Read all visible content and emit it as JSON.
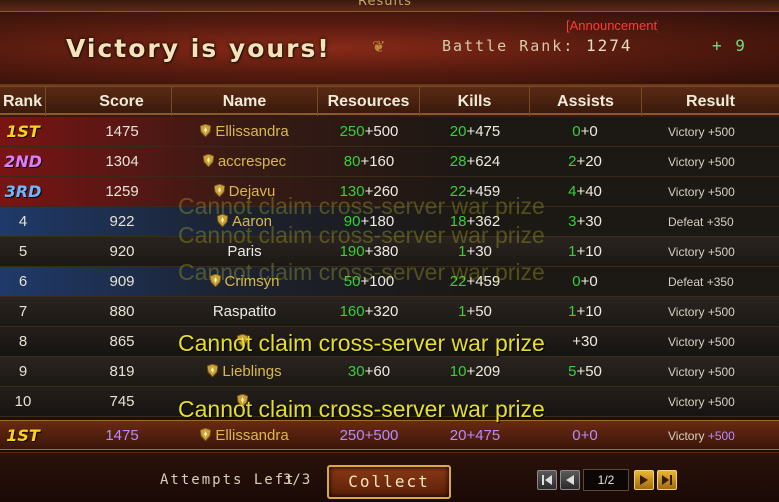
{
  "top_tab": {
    "label": "Results"
  },
  "header": {
    "title": "Victory is yours!",
    "announcement": "[Announcement]",
    "battle_rank_label": "Battle Rank:",
    "battle_rank_value": "1274",
    "rank_change": "+ 9"
  },
  "columns": [
    "Rank",
    "Score",
    "Name",
    "Resources",
    "Kills",
    "Assists",
    "Result"
  ],
  "rows": [
    {
      "rank": "1ST",
      "score": "1475",
      "name": "Ellissandra",
      "shield": true,
      "res_base": "250",
      "res_bonus": "+500",
      "kills_base": "20",
      "kills_bonus": "+475",
      "assists_base": "0",
      "assists_bonus": "+0",
      "result_label": "Victory",
      "result_bonus": "+500"
    },
    {
      "rank": "2ND",
      "score": "1304",
      "name": "accrespec",
      "shield": true,
      "res_base": "80",
      "res_bonus": "+160",
      "kills_base": "28",
      "kills_bonus": "+624",
      "assists_base": "2",
      "assists_bonus": "+20",
      "result_label": "Victory",
      "result_bonus": "+500"
    },
    {
      "rank": "3RD",
      "score": "1259",
      "name": "Dejavu",
      "shield": true,
      "res_base": "130",
      "res_bonus": "+260",
      "kills_base": "22",
      "kills_bonus": "+459",
      "assists_base": "4",
      "assists_bonus": "+40",
      "result_label": "Victory",
      "result_bonus": "+500"
    },
    {
      "rank": "4",
      "score": "922",
      "name": "Aaron",
      "shield": true,
      "res_base": "90",
      "res_bonus": "+180",
      "kills_base": "18",
      "kills_bonus": "+362",
      "assists_base": "3",
      "assists_bonus": "+30",
      "result_label": "Defeat",
      "result_bonus": "+350"
    },
    {
      "rank": "5",
      "score": "920",
      "name": "Paris",
      "shield": false,
      "res_base": "190",
      "res_bonus": "+380",
      "kills_base": "1",
      "kills_bonus": "+30",
      "assists_base": "1",
      "assists_bonus": "+10",
      "result_label": "Victory",
      "result_bonus": "+500"
    },
    {
      "rank": "6",
      "score": "909",
      "name": "Crimsyn",
      "shield": true,
      "res_base": "50",
      "res_bonus": "+100",
      "kills_base": "22",
      "kills_bonus": "+459",
      "assists_base": "0",
      "assists_bonus": "+0",
      "result_label": "Defeat",
      "result_bonus": "+350"
    },
    {
      "rank": "7",
      "score": "880",
      "name": "Raspatito",
      "shield": false,
      "res_base": "160",
      "res_bonus": "+320",
      "kills_base": "1",
      "kills_bonus": "+50",
      "assists_base": "1",
      "assists_bonus": "+10",
      "result_label": "Victory",
      "result_bonus": "+500"
    },
    {
      "rank": "8",
      "score": "865",
      "name": "",
      "shield": true,
      "res_base": "",
      "res_bonus": "",
      "kills_base": "",
      "kills_bonus": "",
      "assists_base": "",
      "assists_bonus": "+30",
      "result_label": "Victory",
      "result_bonus": "+500"
    },
    {
      "rank": "9",
      "score": "819",
      "name": "Lieblings",
      "shield": true,
      "res_base": "30",
      "res_bonus": "+60",
      "kills_base": "10",
      "kills_bonus": "+209",
      "assists_base": "5",
      "assists_bonus": "+50",
      "result_label": "Victory",
      "result_bonus": "+500"
    },
    {
      "rank": "10",
      "score": "745",
      "name": "",
      "shield": true,
      "res_base": "",
      "res_bonus": "",
      "kills_base": "",
      "kills_bonus": "",
      "assists_base": "",
      "assists_bonus": "",
      "result_label": "Victory",
      "result_bonus": "+500"
    }
  ],
  "self_row": {
    "rank": "1ST",
    "score": "1475",
    "name": "Ellissandra",
    "res_base": "250",
    "res_bonus": "+500",
    "kills_base": "20",
    "kills_bonus": "+475",
    "assists_base": "0",
    "assists_bonus": "+0",
    "result_label": "Victory",
    "result_bonus": "+500"
  },
  "overlay_message": "Cannot claim cross-server war prize",
  "footer": {
    "attempts_label": "Attempts Left",
    "attempts_value": "3/3",
    "collect_label": "Collect",
    "page": "1/2"
  },
  "icons": [
    "first-page-icon",
    "prev-page-icon",
    "next-page-icon",
    "last-page-icon",
    "shield-icon"
  ],
  "colors": {
    "accent_gold": "#d8b84a",
    "positive_green": "#36d136",
    "overlay_yellow": "#e6df2a",
    "rank1": "#ffd21a",
    "rank2": "#e07aff",
    "rank3": "#6ab8ff"
  }
}
